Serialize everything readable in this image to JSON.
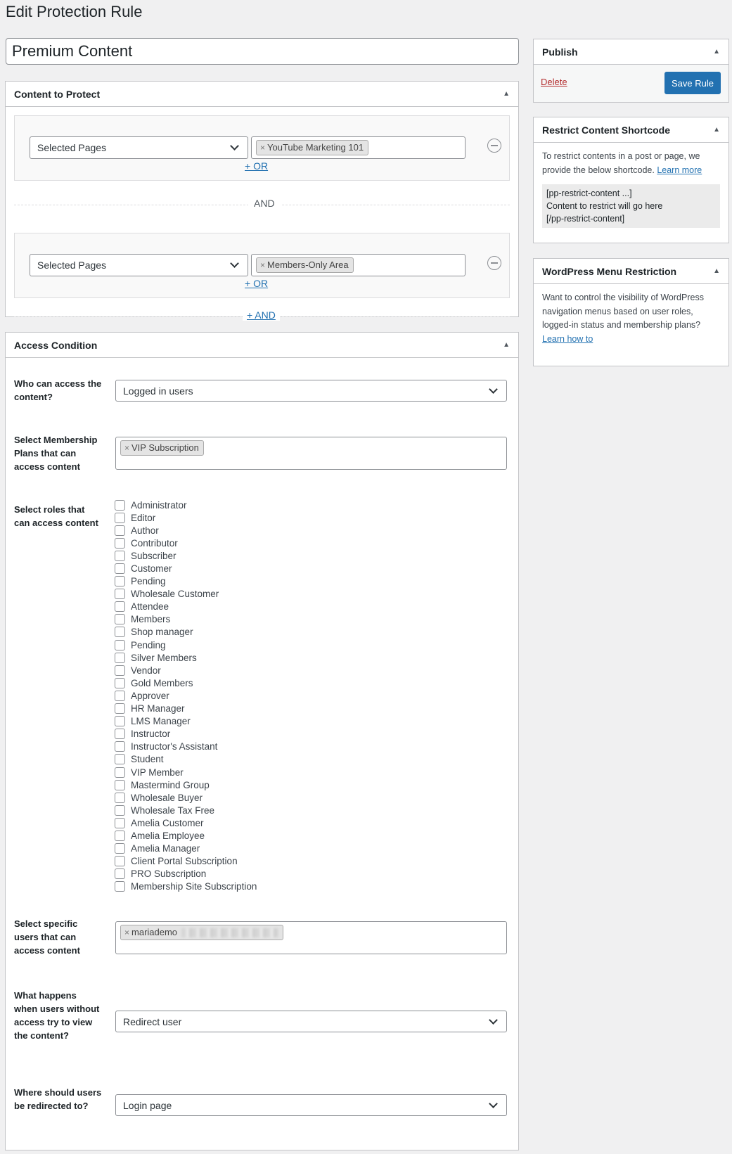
{
  "page_title": "Edit Protection Rule",
  "rule_title": "Premium Content",
  "content_box": {
    "title": "Content to Protect",
    "groups": [
      {
        "type": "Selected Pages",
        "tag": "YouTube Marketing 101",
        "or_label": "+ OR"
      },
      {
        "type": "Selected Pages",
        "tag": "Members-Only Area",
        "or_label": "+ OR"
      }
    ],
    "and_label": "AND",
    "add_and_label": "+ AND"
  },
  "access_box": {
    "title": "Access Condition",
    "who_label": "Who can access the content?",
    "who_value": "Logged in users",
    "plans_label": "Select Membership Plans that can access content",
    "plans_tag": "VIP Subscription",
    "roles_label": "Select roles that can access content",
    "roles": [
      "Administrator",
      "Editor",
      "Author",
      "Contributor",
      "Subscriber",
      "Customer",
      "Pending",
      "Wholesale Customer",
      "Attendee",
      "Members",
      "Shop manager",
      "Pending",
      "Silver Members",
      "Vendor",
      "Gold Members",
      "Approver",
      "HR Manager",
      "LMS Manager",
      "Instructor",
      "Instructor's Assistant",
      "Student",
      "VIP Member",
      "Mastermind Group",
      "Wholesale Buyer",
      "Wholesale Tax Free",
      "Amelia Customer",
      "Amelia Employee",
      "Amelia Manager",
      "Client Portal Subscription",
      "PRO Subscription",
      "Membership Site Subscription"
    ],
    "users_label": "Select specific users that can access content",
    "users_tag": "mariademo",
    "noaccess_label": "What happens when users without access try to view the content?",
    "noaccess_value": "Redirect user",
    "redirect_label": "Where should users be redirected to?",
    "redirect_value": "Login page"
  },
  "publish": {
    "title": "Publish",
    "delete_label": "Delete",
    "save_label": "Save Rule"
  },
  "shortcode_box": {
    "title": "Restrict Content Shortcode",
    "text": "To restrict contents in a post or page, we provide the below shortcode.",
    "link": "Learn more",
    "code_line1": "[pp-restrict-content ...]",
    "code_line2": "Content to restrict will go here",
    "code_line3": "[/pp-restrict-content]"
  },
  "menu_box": {
    "title": "WordPress Menu Restriction",
    "text": "Want to control the visibility of WordPress navigation menus based on user roles, logged-in status and membership plans?",
    "link": "Learn how to"
  }
}
